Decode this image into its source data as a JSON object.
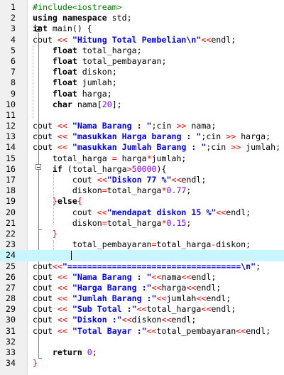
{
  "editor": {
    "lines": [
      {
        "n": "1",
        "segs": [
          {
            "t": "#include<iostream>",
            "c": "pp"
          }
        ]
      },
      {
        "n": "2",
        "segs": [
          {
            "t": "using namespace",
            "c": "kw"
          },
          {
            "t": " std;",
            "c": ""
          }
        ]
      },
      {
        "n": "3",
        "segs": [
          {
            "t": "int",
            "c": "kw"
          },
          {
            "t": " main() {",
            "c": ""
          }
        ]
      },
      {
        "n": "4",
        "segs": [
          {
            "t": "cout ",
            "c": ""
          },
          {
            "t": "<<",
            "c": "op"
          },
          {
            "t": " ",
            "c": ""
          },
          {
            "t": "\"Hitung Total Pembelian\\n\"",
            "c": "str"
          },
          {
            "t": "<<",
            "c": "op"
          },
          {
            "t": "endl;",
            "c": ""
          }
        ]
      },
      {
        "n": "5",
        "segs": [
          {
            "t": "    ",
            "c": ""
          },
          {
            "t": "float",
            "c": "kw"
          },
          {
            "t": " total_harga;",
            "c": ""
          }
        ]
      },
      {
        "n": "6",
        "segs": [
          {
            "t": "    ",
            "c": ""
          },
          {
            "t": "float",
            "c": "kw"
          },
          {
            "t": " total_pembayaran;",
            "c": ""
          }
        ]
      },
      {
        "n": "7",
        "segs": [
          {
            "t": "    ",
            "c": ""
          },
          {
            "t": "float",
            "c": "kw"
          },
          {
            "t": " diskon;",
            "c": ""
          }
        ]
      },
      {
        "n": "8",
        "segs": [
          {
            "t": "    ",
            "c": ""
          },
          {
            "t": "float",
            "c": "kw"
          },
          {
            "t": " jumlah;",
            "c": ""
          }
        ]
      },
      {
        "n": "9",
        "segs": [
          {
            "t": "    ",
            "c": ""
          },
          {
            "t": "float",
            "c": "kw"
          },
          {
            "t": " harga;",
            "c": ""
          }
        ]
      },
      {
        "n": "10",
        "segs": [
          {
            "t": "    ",
            "c": ""
          },
          {
            "t": "char",
            "c": "kw"
          },
          {
            "t": " nama[",
            "c": ""
          },
          {
            "t": "20",
            "c": "num"
          },
          {
            "t": "];",
            "c": ""
          }
        ]
      },
      {
        "n": "11",
        "segs": []
      },
      {
        "n": "12",
        "segs": [
          {
            "t": "cout ",
            "c": ""
          },
          {
            "t": "<<",
            "c": "op"
          },
          {
            "t": " ",
            "c": ""
          },
          {
            "t": "\"Nama Barang : \"",
            "c": "str"
          },
          {
            "t": ";cin ",
            "c": ""
          },
          {
            "t": ">>",
            "c": "op"
          },
          {
            "t": " nama;",
            "c": ""
          }
        ]
      },
      {
        "n": "13",
        "segs": [
          {
            "t": "cout ",
            "c": ""
          },
          {
            "t": "<<",
            "c": "op"
          },
          {
            "t": " ",
            "c": ""
          },
          {
            "t": "\"masukkan Harga barang : \"",
            "c": "str"
          },
          {
            "t": ";cin ",
            "c": ""
          },
          {
            "t": ">>",
            "c": "op"
          },
          {
            "t": " harga;",
            "c": ""
          }
        ]
      },
      {
        "n": "14",
        "segs": [
          {
            "t": "cout ",
            "c": ""
          },
          {
            "t": "<<",
            "c": "op"
          },
          {
            "t": " ",
            "c": ""
          },
          {
            "t": "\"masukkan Jumlah Barang : \"",
            "c": "str"
          },
          {
            "t": ";cin ",
            "c": ""
          },
          {
            "t": ">>",
            "c": "op"
          },
          {
            "t": " jumlah;",
            "c": ""
          }
        ]
      },
      {
        "n": "15",
        "segs": [
          {
            "t": "    total_harga ",
            "c": ""
          },
          {
            "t": "=",
            "c": "op"
          },
          {
            "t": " harga",
            "c": ""
          },
          {
            "t": "*",
            "c": "op"
          },
          {
            "t": "jumlah;",
            "c": ""
          }
        ]
      },
      {
        "n": "16",
        "segs": [
          {
            "t": "    ",
            "c": ""
          },
          {
            "t": "if",
            "c": "kw"
          },
          {
            "t": " (total_harga",
            "c": ""
          },
          {
            "t": ">",
            "c": "op"
          },
          {
            "t": "50000",
            "c": "num"
          },
          {
            "t": "){",
            "c": ""
          }
        ]
      },
      {
        "n": "17",
        "segs": [
          {
            "t": "        cout ",
            "c": ""
          },
          {
            "t": "<<",
            "c": "op"
          },
          {
            "t": "\"Diskon 77 %\"",
            "c": "str"
          },
          {
            "t": "<<",
            "c": "op"
          },
          {
            "t": "endl;",
            "c": ""
          }
        ]
      },
      {
        "n": "18",
        "segs": [
          {
            "t": "        diskon",
            "c": ""
          },
          {
            "t": "=",
            "c": "op"
          },
          {
            "t": "total_harga",
            "c": ""
          },
          {
            "t": "*",
            "c": "op"
          },
          {
            "t": "0.77",
            "c": "num"
          },
          {
            "t": ";",
            "c": ""
          }
        ]
      },
      {
        "n": "19",
        "segs": [
          {
            "t": "    ",
            "c": ""
          },
          {
            "t": "}",
            "c": "op"
          },
          {
            "t": "else",
            "c": "kw"
          },
          {
            "t": "{",
            "c": "op"
          }
        ]
      },
      {
        "n": "20",
        "segs": [
          {
            "t": "        cout ",
            "c": ""
          },
          {
            "t": "<<",
            "c": "op"
          },
          {
            "t": "\"mendapat diskon 15 %\"",
            "c": "str"
          },
          {
            "t": "<<",
            "c": "op"
          },
          {
            "t": "endl;",
            "c": ""
          }
        ]
      },
      {
        "n": "21",
        "segs": [
          {
            "t": "        diskon",
            "c": ""
          },
          {
            "t": "=",
            "c": "op"
          },
          {
            "t": "total_harga",
            "c": ""
          },
          {
            "t": "*",
            "c": "op"
          },
          {
            "t": "0.15",
            "c": "num"
          },
          {
            "t": ";",
            "c": ""
          }
        ]
      },
      {
        "n": "22",
        "segs": [
          {
            "t": "    ",
            "c": ""
          },
          {
            "t": "}",
            "c": "op"
          }
        ]
      },
      {
        "n": "23",
        "segs": [
          {
            "t": "        total_pembayaran",
            "c": ""
          },
          {
            "t": "=",
            "c": "op"
          },
          {
            "t": "total_harga",
            "c": ""
          },
          {
            "t": "-",
            "c": "op"
          },
          {
            "t": "diskon;",
            "c": ""
          }
        ]
      },
      {
        "n": "24",
        "segs": [],
        "current": true
      },
      {
        "n": "25",
        "segs": [
          {
            "t": "cout",
            "c": ""
          },
          {
            "t": "<<",
            "c": "op"
          },
          {
            "t": "\"===================================\\n\"",
            "c": "str"
          },
          {
            "t": ";",
            "c": ""
          }
        ]
      },
      {
        "n": "26",
        "segs": [
          {
            "t": "cout ",
            "c": ""
          },
          {
            "t": "<<",
            "c": "op"
          },
          {
            "t": " ",
            "c": ""
          },
          {
            "t": "\"Nama Barang : \"",
            "c": "str"
          },
          {
            "t": "<<",
            "c": "op"
          },
          {
            "t": "nama",
            "c": ""
          },
          {
            "t": "<<",
            "c": "op"
          },
          {
            "t": "endl;",
            "c": ""
          }
        ]
      },
      {
        "n": "27",
        "segs": [
          {
            "t": "cout ",
            "c": ""
          },
          {
            "t": "<<",
            "c": "op"
          },
          {
            "t": " ",
            "c": ""
          },
          {
            "t": "\"Harga Barang :\"",
            "c": "str"
          },
          {
            "t": "<<",
            "c": "op"
          },
          {
            "t": "harga",
            "c": ""
          },
          {
            "t": "<<",
            "c": "op"
          },
          {
            "t": "endl;",
            "c": ""
          }
        ]
      },
      {
        "n": "28",
        "segs": [
          {
            "t": "cout ",
            "c": ""
          },
          {
            "t": "<<",
            "c": "op"
          },
          {
            "t": " ",
            "c": ""
          },
          {
            "t": "\"Jumlah Barang :\"",
            "c": "str"
          },
          {
            "t": "<<",
            "c": "op"
          },
          {
            "t": "jumlah",
            "c": ""
          },
          {
            "t": "<<",
            "c": "op"
          },
          {
            "t": "endl;",
            "c": ""
          }
        ]
      },
      {
        "n": "29",
        "segs": [
          {
            "t": "cout ",
            "c": ""
          },
          {
            "t": "<<",
            "c": "op"
          },
          {
            "t": " ",
            "c": ""
          },
          {
            "t": "\"Sub Total :\"",
            "c": "str"
          },
          {
            "t": "<<",
            "c": "op"
          },
          {
            "t": "total_harga",
            "c": ""
          },
          {
            "t": "<<",
            "c": "op"
          },
          {
            "t": "endl;",
            "c": ""
          }
        ]
      },
      {
        "n": "30",
        "segs": [
          {
            "t": "cout ",
            "c": ""
          },
          {
            "t": "<<",
            "c": "op"
          },
          {
            "t": " ",
            "c": ""
          },
          {
            "t": "\"Diskon :\"",
            "c": "str"
          },
          {
            "t": "<<",
            "c": "op"
          },
          {
            "t": "diskon",
            "c": ""
          },
          {
            "t": "<<",
            "c": "op"
          },
          {
            "t": "endl;",
            "c": ""
          }
        ]
      },
      {
        "n": "31",
        "segs": [
          {
            "t": "cout ",
            "c": ""
          },
          {
            "t": "<<",
            "c": "op"
          },
          {
            "t": " ",
            "c": ""
          },
          {
            "t": "\"Total Bayar :\"",
            "c": "str"
          },
          {
            "t": "<<",
            "c": "op"
          },
          {
            "t": "total_pembayaran",
            "c": ""
          },
          {
            "t": "<<",
            "c": "op"
          },
          {
            "t": "endl;",
            "c": ""
          }
        ]
      },
      {
        "n": "32",
        "segs": []
      },
      {
        "n": "33",
        "segs": [
          {
            "t": "    ",
            "c": ""
          },
          {
            "t": "return",
            "c": "kw"
          },
          {
            "t": " ",
            "c": ""
          },
          {
            "t": "0",
            "c": "num"
          },
          {
            "t": ";",
            "c": ""
          }
        ]
      },
      {
        "n": "34",
        "segs": [
          {
            "t": "}",
            "c": "op"
          }
        ]
      }
    ],
    "colors": {
      "keyword": "#000000",
      "string": "#0000ff",
      "number": "#8000ff",
      "operator": "#ff0000",
      "preprocessor": "#008000",
      "current_line": "#c8f5ff"
    }
  }
}
